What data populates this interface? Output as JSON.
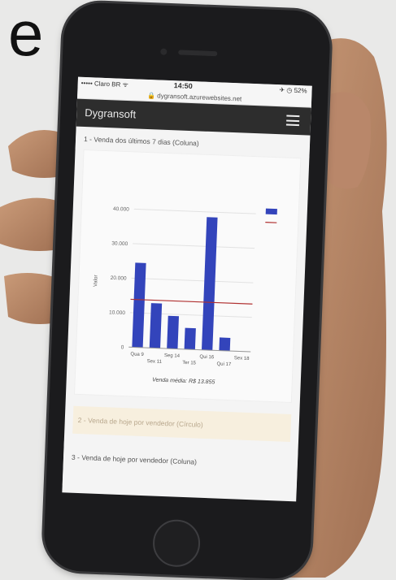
{
  "overlay_letter": "e",
  "status_bar": {
    "carrier": "••••• Claro BR ᯤ",
    "time": "14:50",
    "battery": "✈ ◷ 52%"
  },
  "browser": {
    "url": "🔒 dygransoft.azurewebsites.net"
  },
  "app": {
    "title": "Dygransoft"
  },
  "sections": [
    {
      "label": "1 - Venda dos últimos 7 dias (Coluna)"
    },
    {
      "label": "2 - Venda de hoje por vendedor (Círculo)"
    },
    {
      "label": "3 - Venda de hoje por vendedor (Coluna)"
    }
  ],
  "chart_data": {
    "type": "bar",
    "categories": [
      "Qua 9",
      "Sex 11",
      "Seg 14",
      "Ter 15",
      "Qui 16",
      "Qui 17",
      "Sex 18"
    ],
    "category_label_rows": [
      0,
      1,
      0,
      1,
      0,
      1,
      0
    ],
    "values": [
      24500,
      13000,
      9500,
      6200,
      38500,
      3800,
      0
    ],
    "reference_line": 13855,
    "ylim": [
      0,
      40000
    ],
    "yticks": [
      "0",
      "10.000",
      "20.000",
      "30.000",
      "40.000"
    ],
    "ylabel": "Valor",
    "note": "Venda média: R$ 13.855",
    "colors": {
      "bar": "#3344bb",
      "line": "#b03030"
    }
  }
}
